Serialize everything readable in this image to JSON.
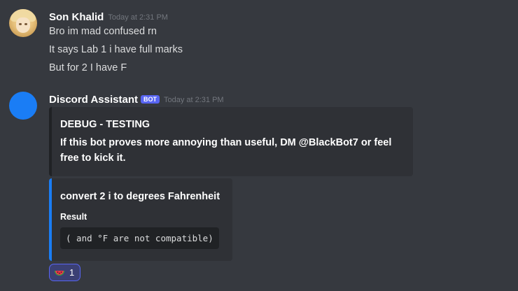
{
  "messages": [
    {
      "author": "Son Khalid",
      "timestamp": "Today at 2:31 PM",
      "lines": [
        "Bro im mad confused rn",
        "It says Lab 1 i have full marks",
        "But for 2 I have F"
      ]
    },
    {
      "author": "Discord Assistant",
      "bot_tag": "BOT",
      "timestamp": "Today at 2:31 PM",
      "embeds": [
        {
          "title": "DEBUG - TESTING",
          "description": "If this bot proves more annoying than useful, DM @BlackBot7 or feel free to kick it."
        },
        {
          "title": "convert 2 i to degrees Fahrenheit",
          "field_name": "Result",
          "field_value": "( and °F are not compatible)"
        }
      ],
      "reaction": {
        "emoji": "watermelon-icon",
        "count": "1"
      }
    }
  ],
  "colors": {
    "background": "#36393f",
    "embed_bg": "#2f3136",
    "bot_tag": "#5865f2",
    "embed_accent": "#1a7df5",
    "bot_avatar": "#1a7df5"
  }
}
